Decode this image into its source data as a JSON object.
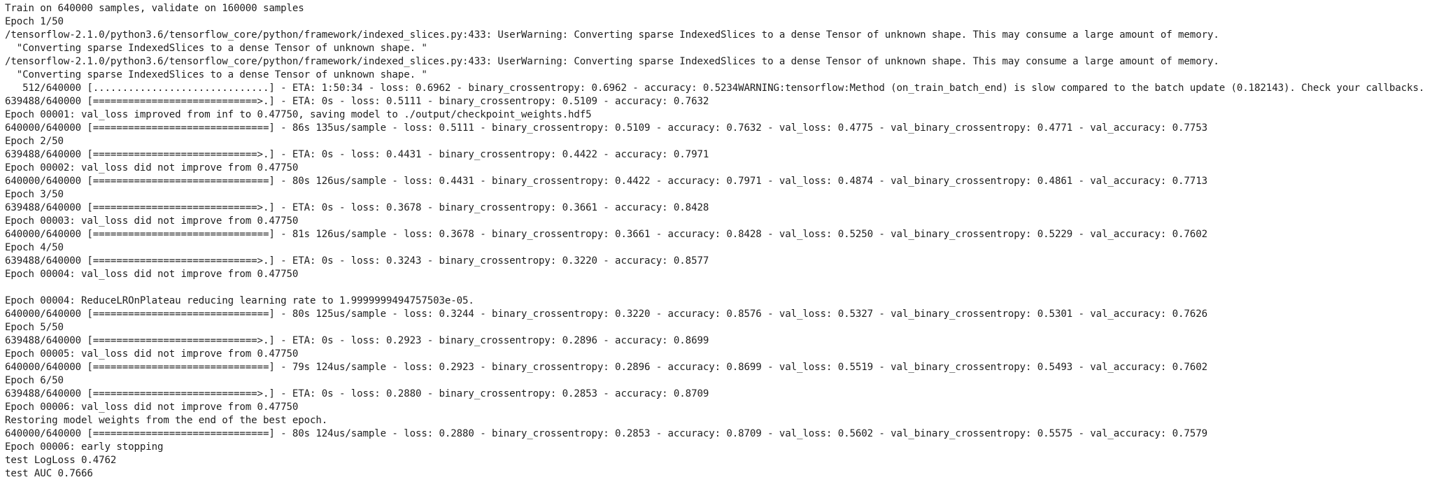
{
  "terminal": {
    "lines": [
      "Train on 640000 samples, validate on 160000 samples",
      "Epoch 1/50",
      "/tensorflow-2.1.0/python3.6/tensorflow_core/python/framework/indexed_slices.py:433: UserWarning: Converting sparse IndexedSlices to a dense Tensor of unknown shape. This may consume a large amount of memory.",
      "  \"Converting sparse IndexedSlices to a dense Tensor of unknown shape. \"",
      "/tensorflow-2.1.0/python3.6/tensorflow_core/python/framework/indexed_slices.py:433: UserWarning: Converting sparse IndexedSlices to a dense Tensor of unknown shape. This may consume a large amount of memory.",
      "  \"Converting sparse IndexedSlices to a dense Tensor of unknown shape. \"",
      "   512/640000 [..............................] - ETA: 1:50:34 - loss: 0.6962 - binary_crossentropy: 0.6962 - accuracy: 0.5234WARNING:tensorflow:Method (on_train_batch_end) is slow compared to the batch update (0.182143). Check your callbacks.",
      "639488/640000 [============================>.] - ETA: 0s - loss: 0.5111 - binary_crossentropy: 0.5109 - accuracy: 0.7632",
      "Epoch 00001: val_loss improved from inf to 0.47750, saving model to ./output/checkpoint_weights.hdf5",
      "640000/640000 [==============================] - 86s 135us/sample - loss: 0.5111 - binary_crossentropy: 0.5109 - accuracy: 0.7632 - val_loss: 0.4775 - val_binary_crossentropy: 0.4771 - val_accuracy: 0.7753",
      "Epoch 2/50",
      "639488/640000 [============================>.] - ETA: 0s - loss: 0.4431 - binary_crossentropy: 0.4422 - accuracy: 0.7971",
      "Epoch 00002: val_loss did not improve from 0.47750",
      "640000/640000 [==============================] - 80s 126us/sample - loss: 0.4431 - binary_crossentropy: 0.4422 - accuracy: 0.7971 - val_loss: 0.4874 - val_binary_crossentropy: 0.4861 - val_accuracy: 0.7713",
      "Epoch 3/50",
      "639488/640000 [============================>.] - ETA: 0s - loss: 0.3678 - binary_crossentropy: 0.3661 - accuracy: 0.8428",
      "Epoch 00003: val_loss did not improve from 0.47750",
      "640000/640000 [==============================] - 81s 126us/sample - loss: 0.3678 - binary_crossentropy: 0.3661 - accuracy: 0.8428 - val_loss: 0.5250 - val_binary_crossentropy: 0.5229 - val_accuracy: 0.7602",
      "Epoch 4/50",
      "639488/640000 [============================>.] - ETA: 0s - loss: 0.3243 - binary_crossentropy: 0.3220 - accuracy: 0.8577",
      "Epoch 00004: val_loss did not improve from 0.47750",
      "",
      "Epoch 00004: ReduceLROnPlateau reducing learning rate to 1.9999999494757503e-05.",
      "640000/640000 [==============================] - 80s 125us/sample - loss: 0.3244 - binary_crossentropy: 0.3220 - accuracy: 0.8576 - val_loss: 0.5327 - val_binary_crossentropy: 0.5301 - val_accuracy: 0.7626",
      "Epoch 5/50",
      "639488/640000 [============================>.] - ETA: 0s - loss: 0.2923 - binary_crossentropy: 0.2896 - accuracy: 0.8699",
      "Epoch 00005: val_loss did not improve from 0.47750",
      "640000/640000 [==============================] - 79s 124us/sample - loss: 0.2923 - binary_crossentropy: 0.2896 - accuracy: 0.8699 - val_loss: 0.5519 - val_binary_crossentropy: 0.5493 - val_accuracy: 0.7602",
      "Epoch 6/50",
      "639488/640000 [============================>.] - ETA: 0s - loss: 0.2880 - binary_crossentropy: 0.2853 - accuracy: 0.8709",
      "Epoch 00006: val_loss did not improve from 0.47750",
      "Restoring model weights from the end of the best epoch.",
      "640000/640000 [==============================] - 80s 124us/sample - loss: 0.2880 - binary_crossentropy: 0.2853 - accuracy: 0.8709 - val_loss: 0.5602 - val_binary_crossentropy: 0.5575 - val_accuracy: 0.7579",
      "Epoch 00006: early stopping",
      "test LogLoss 0.4762",
      "test AUC 0.7666"
    ]
  }
}
